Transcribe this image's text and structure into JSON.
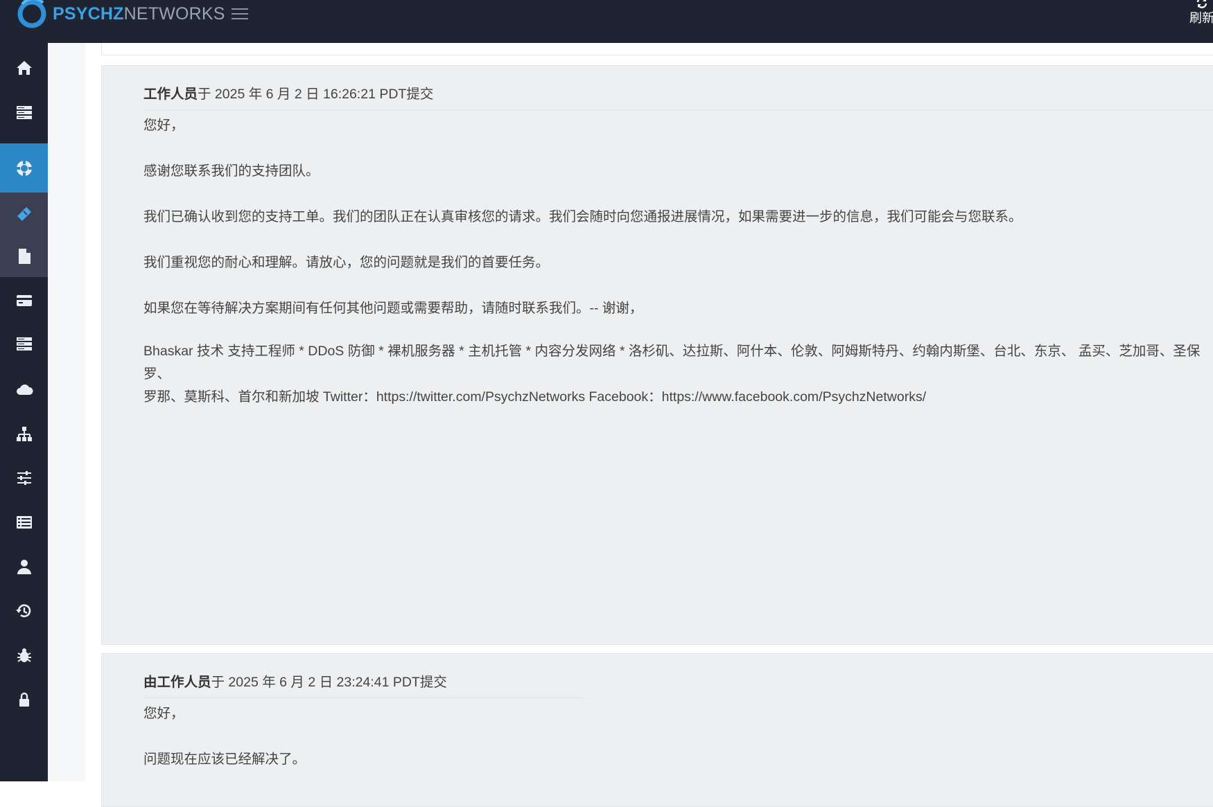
{
  "app": {
    "logo_text_strong": "PSYCHZ",
    "logo_text_light": "NETWORKS",
    "refresh_label": "刷新"
  },
  "sidebar": {
    "items": [
      {
        "name": "home-icon"
      },
      {
        "name": "servers-icon"
      },
      {
        "name": "support-lifebuoy-icon",
        "active": true
      },
      {
        "name": "ticket-icon"
      },
      {
        "name": "file-icon"
      },
      {
        "name": "credit-card-icon"
      },
      {
        "name": "server-list-icon"
      },
      {
        "name": "cloud-icon"
      },
      {
        "name": "network-icon"
      },
      {
        "name": "sliders-icon"
      },
      {
        "name": "list-icon"
      },
      {
        "name": "user-icon"
      },
      {
        "name": "history-icon"
      },
      {
        "name": "bug-icon"
      },
      {
        "name": "lock-icon"
      }
    ]
  },
  "colors": {
    "topbar": "#1f2433",
    "active_nav": "#2b87c8",
    "card_bg": "#eeeff0"
  },
  "replies": [
    {
      "author": "工作人员",
      "submitted": "于 2025 年 6 月 2 日 16:26:21 PDT提交",
      "paragraphs": [
        "您好，",
        "感谢您联系我们的支持团队。",
        "我们已确认收到您的支持工单。我们的团队正在认真审核您的请求。我们会随时向您通报进展情况，如果需要进一步的信息，我们可能会与您联系。",
        "我们重视您的耐心和理解。请放心，您的问题就是我们的首要任务。",
        "如果您在等待解决方案期间有任何其他问题或需要帮助，请随时联系我们。-- 谢谢，"
      ],
      "signature_line1": "Bhaskar 技术 支持工程师 * DDoS 防御 * 裸机服务器 * 主机托管 * 内容分发网络 * 洛杉矶、达拉斯、阿什本、伦敦、阿姆斯特丹、约翰内斯堡、台北、东京、 孟买、芝加哥、圣保罗、",
      "signature_line2": "罗那、莫斯科、首尔和新加坡 Twitter：https://twitter.com/PsychzNetworks Facebook：https://www.facebook.com/PsychzNetworks/"
    },
    {
      "author": "由工作人员",
      "submitted": "于 2025 年 6 月 2 日 23:24:41 PDT提交",
      "paragraphs": [
        "您好，",
        "问题现在应该已经解决了。"
      ]
    }
  ]
}
